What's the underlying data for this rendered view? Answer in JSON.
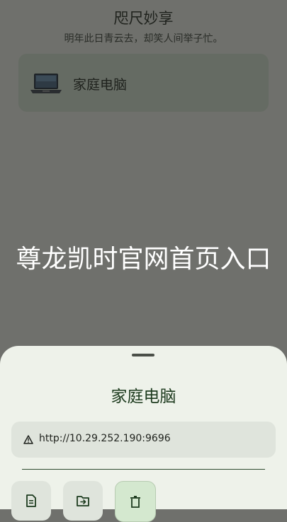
{
  "header": {
    "title": "咫尺妙享",
    "subtitle": "明年此日青云去，却笑人间举子忙。"
  },
  "devices": [
    {
      "name": "家庭电脑",
      "icon": "laptop-icon"
    }
  ],
  "overlay": {
    "text": "尊龙凯时官网首页入口"
  },
  "sheet": {
    "title": "家庭电脑",
    "url": "http://10.29.252.190:9696",
    "url_icon": "warning-icon",
    "actions": [
      {
        "icon": "file-icon"
      },
      {
        "icon": "folder-send-icon"
      },
      {
        "icon": "trash-icon"
      }
    ]
  },
  "colors": {
    "background_dim": "#6f706c",
    "sheet": "#eef2ea",
    "accent_green": "#1d3b1e",
    "field": "#dfe4dc"
  }
}
